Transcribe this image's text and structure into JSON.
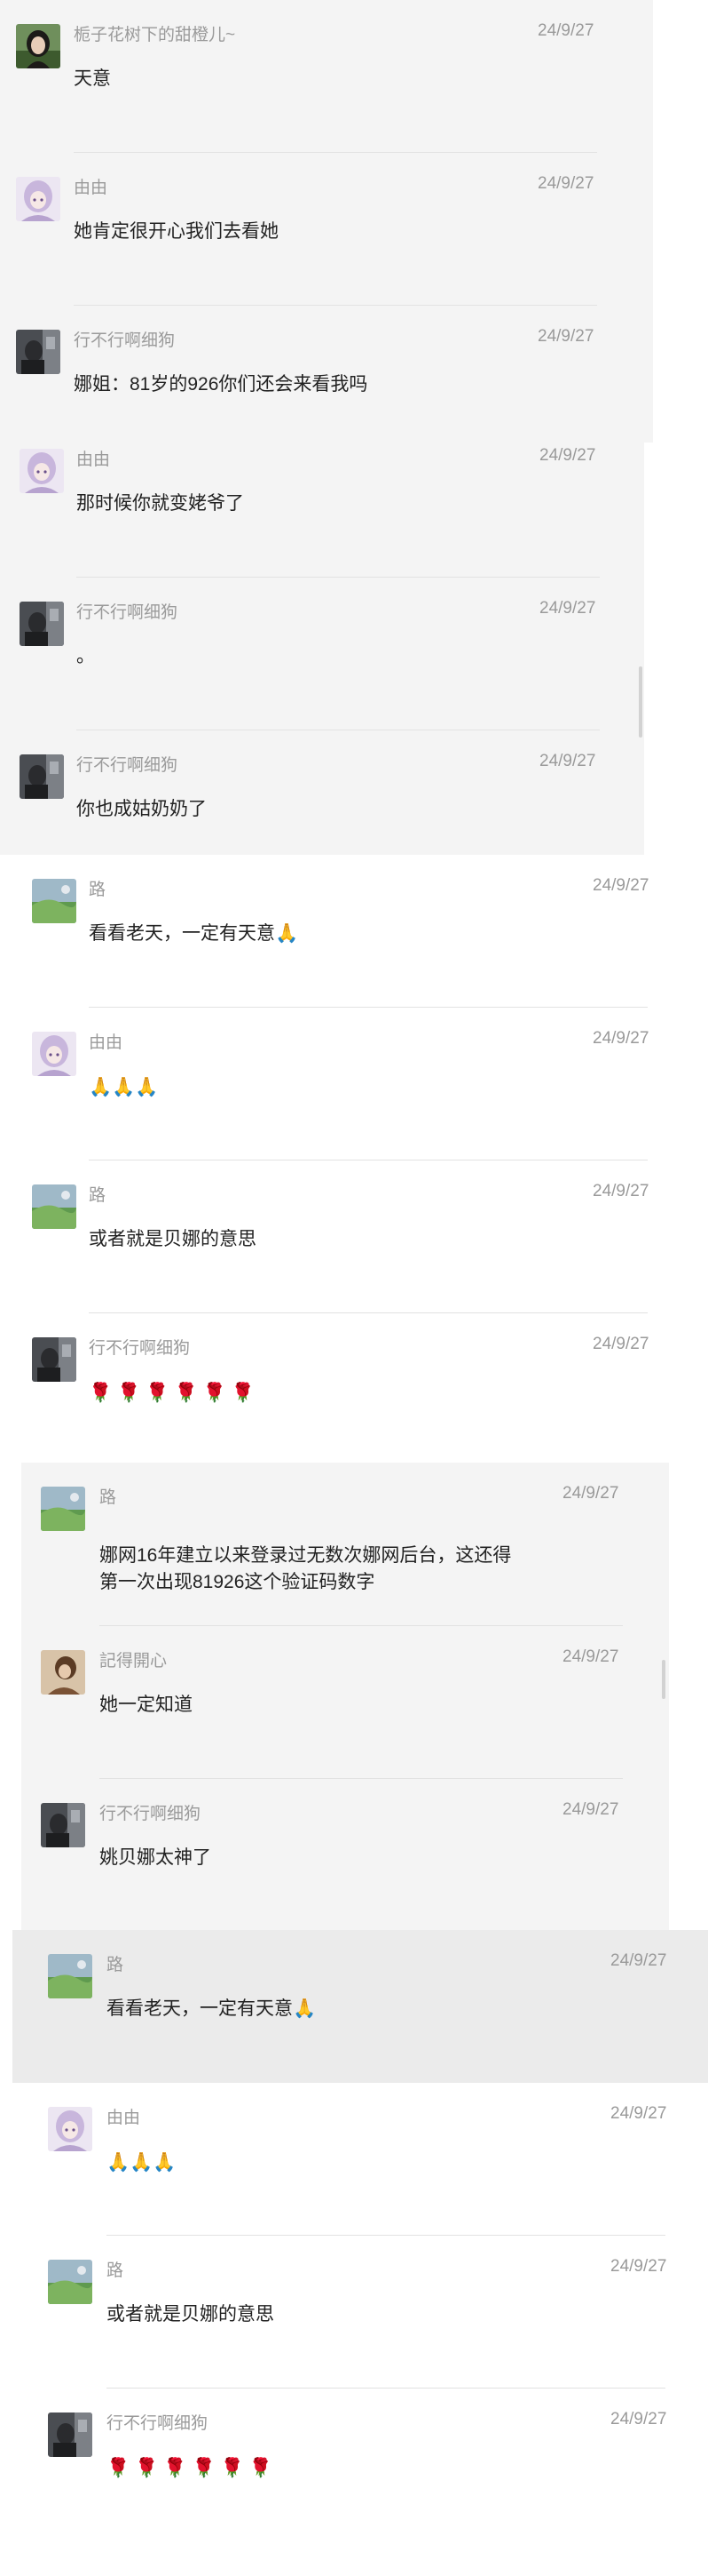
{
  "colors": {
    "panel_grey": "#f4f4f4",
    "panel_selected": "#ebebeb",
    "name_text": "#9a9a9a",
    "message_text": "#222222",
    "divider": "#e2e2e2"
  },
  "panels": [
    {
      "messages": [
        {
          "avatar": "avatar-girl-dark-hair",
          "name": "栀子花树下的甜橙儿~",
          "time": "24/9/27",
          "text": "天意"
        },
        {
          "avatar": "avatar-anime-lilac",
          "name": "由由",
          "time": "24/9/27",
          "text": "她肯定很开心我们去看她"
        },
        {
          "avatar": "avatar-photo-dark",
          "name": "行不行啊细狗",
          "time": "24/9/27",
          "text": "娜姐：81岁的926你们还会来看我吗"
        }
      ]
    },
    {
      "messages": [
        {
          "avatar": "avatar-anime-lilac",
          "name": "由由",
          "time": "24/9/27",
          "text": "那时候你就变姥爷了"
        },
        {
          "avatar": "avatar-photo-dark",
          "name": "行不行啊细狗",
          "time": "24/9/27",
          "text": "。"
        },
        {
          "avatar": "avatar-photo-dark",
          "name": "行不行啊细狗",
          "time": "24/9/27",
          "text": "你也成姑奶奶了"
        }
      ]
    },
    {
      "messages": [
        {
          "avatar": "avatar-landscape",
          "name": "路",
          "time": "24/9/27",
          "text": "看看老天，一定有天意🙏"
        },
        {
          "avatar": "avatar-anime-lilac",
          "name": "由由",
          "time": "24/9/27",
          "text": "🙏🙏🙏"
        },
        {
          "avatar": "avatar-landscape",
          "name": "路",
          "time": "24/9/27",
          "text": "或者就是贝娜的意思"
        },
        {
          "avatar": "avatar-photo-dark",
          "name": "行不行啊细狗",
          "time": "24/9/27",
          "text": "🌹🌹🌹🌹🌹🌹"
        }
      ]
    },
    {
      "messages": [
        {
          "avatar": "avatar-landscape",
          "name": "路",
          "time": "24/9/27",
          "text_lines": [
            "娜网16年建立以来登录过无数次娜网后台，这还得",
            "第一次出现81926这个验证码数字"
          ]
        },
        {
          "avatar": "avatar-person-brown",
          "name": "記得開心",
          "time": "24/9/27",
          "text": "她一定知道"
        },
        {
          "avatar": "avatar-photo-dark",
          "name": "行不行啊细狗",
          "time": "24/9/27",
          "text": "姚贝娜太神了"
        }
      ]
    },
    {
      "messages": [
        {
          "avatar": "avatar-landscape",
          "name": "路",
          "time": "24/9/27",
          "text": "看看老天，一定有天意🙏"
        },
        {
          "avatar": "avatar-anime-lilac",
          "name": "由由",
          "time": "24/9/27",
          "text": "🙏🙏🙏"
        },
        {
          "avatar": "avatar-landscape",
          "name": "路",
          "time": "24/9/27",
          "text": "或者就是贝娜的意思"
        },
        {
          "avatar": "avatar-photo-dark",
          "name": "行不行啊细狗",
          "time": "24/9/27",
          "text": "🌹🌹🌹🌹🌹🌹"
        }
      ]
    }
  ]
}
